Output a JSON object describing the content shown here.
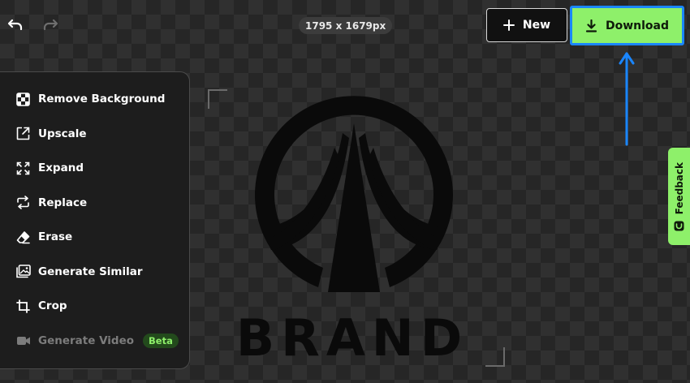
{
  "toolbar": {
    "undo_icon": "undo-icon",
    "redo_icon": "redo-icon",
    "dimensions": "1795 x 1679px",
    "new_label": "New",
    "download_label": "Download"
  },
  "menu": {
    "items": [
      {
        "label": "Remove Background",
        "icon": "remove-background-icon"
      },
      {
        "label": "Upscale",
        "icon": "upscale-icon"
      },
      {
        "label": "Expand",
        "icon": "expand-icon"
      },
      {
        "label": "Replace",
        "icon": "replace-icon"
      },
      {
        "label": "Erase",
        "icon": "eraser-icon"
      },
      {
        "label": "Generate Similar",
        "icon": "image-icon"
      },
      {
        "label": "Crop",
        "icon": "crop-icon"
      },
      {
        "label": "Generate Video",
        "icon": "video-camera-icon",
        "badge": "Beta",
        "disabled": true
      }
    ]
  },
  "canvas": {
    "image_text": "BRAND"
  },
  "feedback": {
    "label": "Feedback"
  },
  "colors": {
    "accent": "#8ef06a",
    "highlight": "#1a86ff",
    "panel": "#1d1d1d"
  }
}
